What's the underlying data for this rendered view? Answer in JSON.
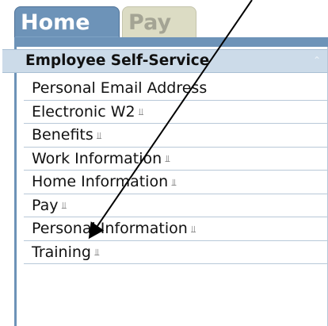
{
  "tabs": [
    {
      "label": "Home",
      "active": true
    },
    {
      "label": "Pay",
      "active": false
    }
  ],
  "panel": {
    "title": "Employee Self-Service",
    "collapse_icon": "chevron-up-icon"
  },
  "menu": {
    "items": [
      {
        "label": "Personal Email Address",
        "expandable": false
      },
      {
        "label": "Electronic W2",
        "expandable": true
      },
      {
        "label": "Benefits",
        "expandable": true
      },
      {
        "label": "Work Information",
        "expandable": true
      },
      {
        "label": "Home Information",
        "expandable": true
      },
      {
        "label": "Pay",
        "expandable": true
      },
      {
        "label": "Personal Information",
        "expandable": true
      },
      {
        "label": "Training",
        "expandable": true
      }
    ],
    "expand_icon": "double-chevron-down-icon"
  },
  "annotation": {
    "type": "arrow",
    "points_to": "Pay"
  },
  "colors": {
    "active_tab": "#6d93b8",
    "inactive_tab": "#dcdcc4",
    "header_bg": "#ccdbe9",
    "divider": "#b8c8d8"
  }
}
